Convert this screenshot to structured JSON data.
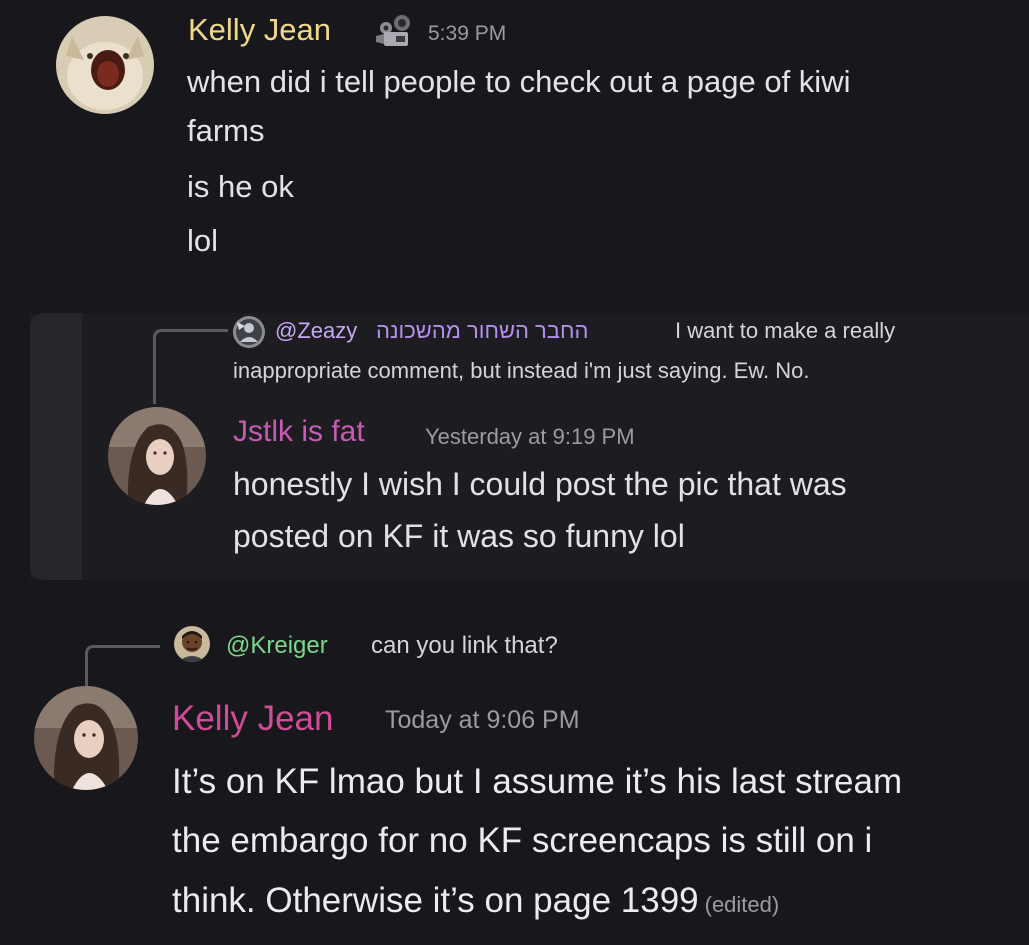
{
  "messages": [
    {
      "author": "Kelly Jean",
      "timestamp": "5:39 PM",
      "lines": [
        "when did i tell people to check out a page of kiwi",
        "farms",
        "is he ok",
        "lol"
      ],
      "name_color": "#f1d889",
      "badge_icon": "camera-badge-icon"
    },
    {
      "reply": {
        "mention": "@Zeazy",
        "author": "החבר השחור מהשכונה",
        "text_line1": "I want to make a really",
        "text_line2": "inappropriate comment, but instead i'm just saying. Ew. No."
      },
      "author": "Jstlk is fat",
      "timestamp": "Yesterday at 9:19 PM",
      "lines": [
        "honestly I wish I could post the pic that was",
        "posted on KF it was so funny lol"
      ],
      "name_color": "#c55bb2"
    },
    {
      "reply": {
        "mention": "@Kreiger",
        "text": "can you link that?"
      },
      "author": "Kelly Jean",
      "timestamp": "Today at 9:06 PM",
      "lines": [
        "It’s on KF lmao but I assume it’s his last stream",
        "the embargo for no KF screencaps is still on i",
        "think. Otherwise it’s on page 1399"
      ],
      "edited": "(edited)",
      "name_color": "#d04c98"
    }
  ],
  "colors": {
    "background": "#18181c",
    "highlight": "#1c1c21",
    "mention_purple": "#c7a8f2",
    "mention_green": "#7ad88a",
    "timestamp": "#9a9ba3"
  }
}
